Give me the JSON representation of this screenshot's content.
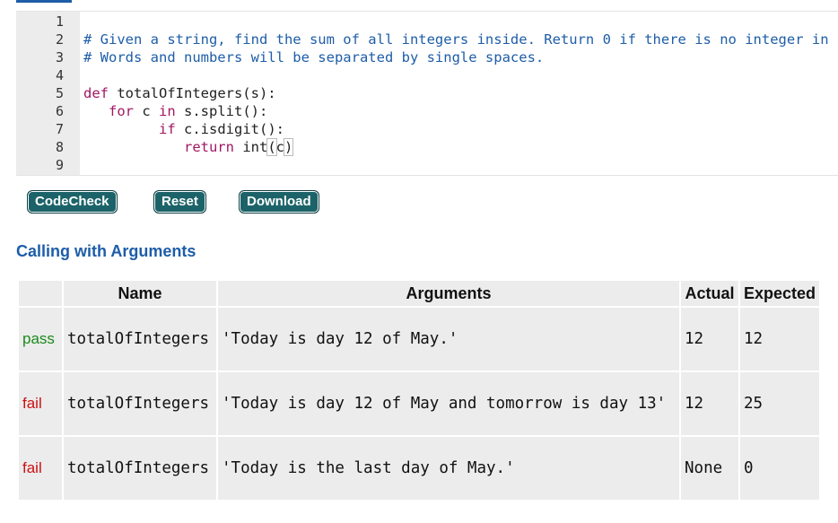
{
  "editor": {
    "line_numbers": [
      "1",
      "2",
      "3",
      "4",
      "5",
      "6",
      "7",
      "8",
      "9"
    ],
    "lines": [
      {
        "indent": "",
        "parts": []
      },
      {
        "indent": "",
        "parts": [
          {
            "t": "comment",
            "v": "# Given a string, find the sum of all integers inside. Return 0 if there is no integer in"
          }
        ]
      },
      {
        "indent": "",
        "parts": [
          {
            "t": "comment",
            "v": "# Words and numbers will be separated by single spaces."
          }
        ]
      },
      {
        "indent": "",
        "parts": []
      },
      {
        "indent": "",
        "parts": [
          {
            "t": "keyword",
            "v": "def"
          },
          {
            "t": "plain",
            "v": " totalOfIntegers(s):"
          }
        ]
      },
      {
        "indent": "   ",
        "parts": [
          {
            "t": "keyword",
            "v": "for"
          },
          {
            "t": "plain",
            "v": " c "
          },
          {
            "t": "keyword",
            "v": "in"
          },
          {
            "t": "plain",
            "v": " s.split():"
          }
        ]
      },
      {
        "indent": "         ",
        "parts": [
          {
            "t": "keyword",
            "v": "if"
          },
          {
            "t": "plain",
            "v": " c.isdigit():"
          }
        ]
      },
      {
        "indent": "            ",
        "parts": [
          {
            "t": "keyword",
            "v": "return"
          },
          {
            "t": "plain",
            "v": " int"
          },
          {
            "t": "bracket",
            "v": "("
          },
          {
            "t": "plain",
            "v": "c"
          },
          {
            "t": "bracket",
            "v": ")"
          }
        ]
      },
      {
        "indent": "",
        "parts": []
      }
    ]
  },
  "buttons": {
    "codecheck": "CodeCheck",
    "reset": "Reset",
    "download": "Download"
  },
  "section_title": "Calling with Arguments",
  "table": {
    "headers": {
      "status": "",
      "name": "Name",
      "arguments": "Arguments",
      "actual": "Actual",
      "expected": "Expected"
    },
    "rows": [
      {
        "status": "pass",
        "name": "totalOfIntegers",
        "arguments": "'Today is day 12 of May.'",
        "actual": "12",
        "expected": "12"
      },
      {
        "status": "fail",
        "name": "totalOfIntegers",
        "arguments": "'Today is day 12 of May and tomorrow is day 13'",
        "actual": "12",
        "expected": "25"
      },
      {
        "status": "fail",
        "name": "totalOfIntegers",
        "arguments": "'Today is the last day of May.'",
        "actual": "None",
        "expected": "0"
      }
    ]
  },
  "colors": {
    "comment": "#1e5da8",
    "keyword": "#a01763",
    "button_bg": "#1c6369",
    "pass": "#1a8a1a",
    "fail": "#cc1111",
    "title": "#1e5da8"
  }
}
